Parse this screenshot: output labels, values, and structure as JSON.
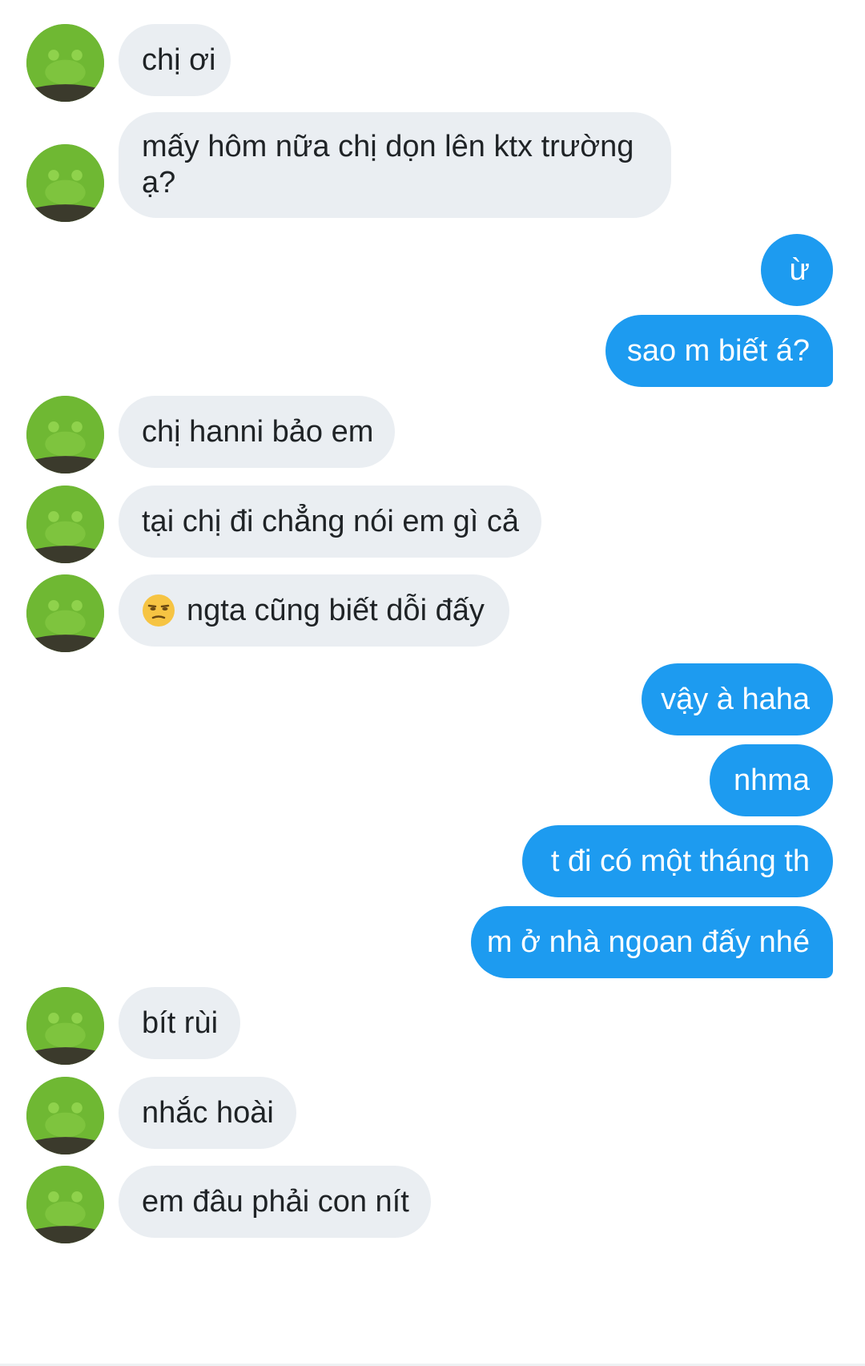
{
  "colors": {
    "incoming_bubble": "#eaeef2",
    "outgoing_bubble": "#1d9bf0",
    "incoming_text": "#1f2326",
    "outgoing_text": "#ffffff"
  },
  "avatar_icon": "green-plush-frog-avatar",
  "messages": [
    {
      "side": "in",
      "text": "chị ơi"
    },
    {
      "side": "in",
      "text": "mấy hôm nữa chị dọn lên ktx trường ạ?"
    },
    {
      "side": "out",
      "text": "ừ"
    },
    {
      "side": "out",
      "text": "sao m biết á?"
    },
    {
      "side": "in",
      "text": "chị hanni bảo em"
    },
    {
      "side": "in",
      "text": "tại chị đi chẳng nói em gì cả"
    },
    {
      "side": "in",
      "emoji": "unamused-face-emoji",
      "text": "ngta cũng biết dỗi đấy"
    },
    {
      "side": "out",
      "text": "vậy à haha"
    },
    {
      "side": "out",
      "text": "nhma"
    },
    {
      "side": "out",
      "text": "t đi có một tháng th"
    },
    {
      "side": "out",
      "text": "m ở nhà ngoan đấy nhé"
    },
    {
      "side": "in",
      "text": "bít rùi"
    },
    {
      "side": "in",
      "text": "nhắc hoài"
    },
    {
      "side": "in",
      "text": "em đâu phải con nít"
    }
  ]
}
